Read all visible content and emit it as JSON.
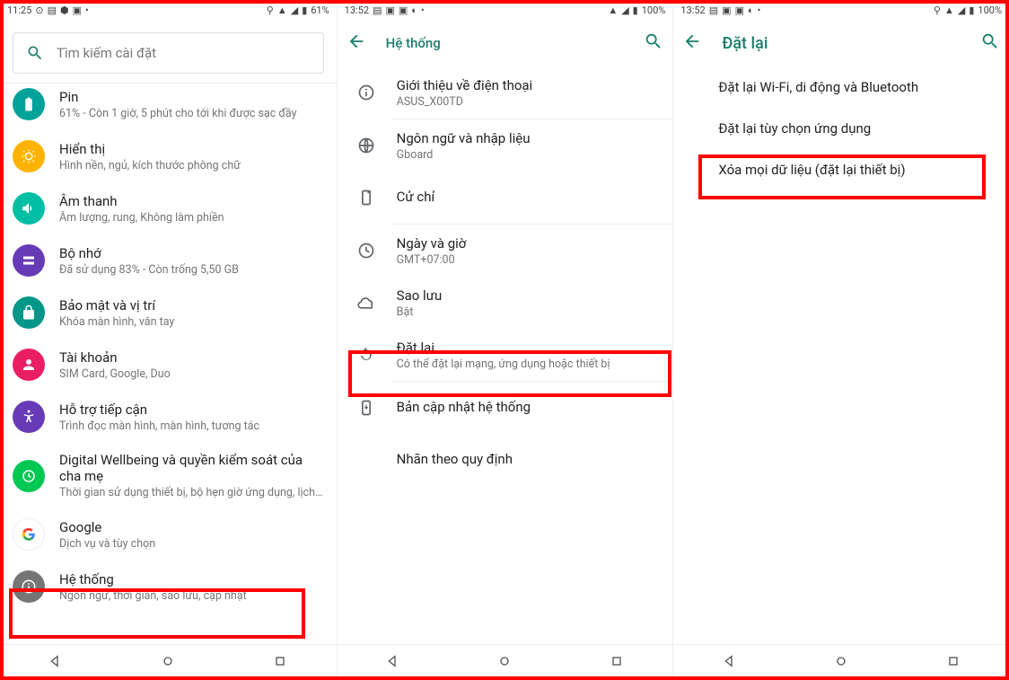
{
  "screen1": {
    "status": {
      "time": "11:25",
      "battery": "61%"
    },
    "search_placeholder": "Tìm kiếm cài đặt",
    "items": [
      {
        "color": "#00a29a",
        "title": "Pin",
        "sub": "61% - Còn 1 giờ, 5 phút cho tới khi được sạc đầy"
      },
      {
        "color": "#ffb300",
        "title": "Hiển thị",
        "sub": "Hình nền, ngủ, kích thước phông chữ"
      },
      {
        "color": "#00bfa5",
        "title": "Âm thanh",
        "sub": "Âm lượng, rung, Không làm phiền"
      },
      {
        "color": "#673ab7",
        "title": "Bộ nhớ",
        "sub": "Đã sử dụng 83% - Còn trống 5,50 GB"
      },
      {
        "color": "#009688",
        "title": "Bảo mật và vị trí",
        "sub": "Khóa màn hình, vân tay"
      },
      {
        "color": "#e91e63",
        "title": "Tài khoản",
        "sub": "SIM Card, Google, Duo"
      },
      {
        "color": "#673ab7",
        "title": "Hỗ trợ tiếp cận",
        "sub": "Trình đọc màn hình, màn hình, tương tác"
      },
      {
        "color": "#00c853",
        "title": "Digital Wellbeing và quyền kiểm soát của cha mẹ",
        "sub": "Thời gian sử dụng thiết bị, bộ hẹn giờ ứng dụng, lịch…"
      },
      {
        "color": "#ffffff",
        "title": "Google",
        "sub": "Dịch vụ và tùy chọn"
      },
      {
        "color": "#757575",
        "title": "Hệ thống",
        "sub": "Ngôn ngữ, thời gian, sao lưu, cập nhật"
      }
    ]
  },
  "screen2": {
    "status": {
      "time": "13:52",
      "battery": "100%"
    },
    "appbar_title": "Hệ thống",
    "items": [
      {
        "title": "Giới thiệu về điện thoại",
        "sub": "ASUS_X00TD"
      },
      {
        "title": "Ngôn ngữ và nhập liệu",
        "sub": "Gboard"
      },
      {
        "title": "Cử chỉ",
        "sub": ""
      },
      {
        "title": "Ngày và giờ",
        "sub": "GMT+07:00"
      },
      {
        "title": "Sao lưu",
        "sub": "Bật"
      },
      {
        "title": "Đặt lại",
        "sub": "Có thể đặt lại mạng, ứng dụng hoặc thiết bị"
      },
      {
        "title": "Bản cập nhật hệ thống",
        "sub": ""
      },
      {
        "title": "Nhãn theo quy định",
        "sub": ""
      }
    ]
  },
  "screen3": {
    "status": {
      "time": "13:52",
      "battery": "100%"
    },
    "appbar_title": "Đặt lại",
    "items": [
      "Đặt lại Wi-Fi, di động và Bluetooth",
      "Đặt lại tùy chọn ứng dụng",
      "Xóa mọi dữ liệu (đặt lại thiết bị)"
    ]
  }
}
